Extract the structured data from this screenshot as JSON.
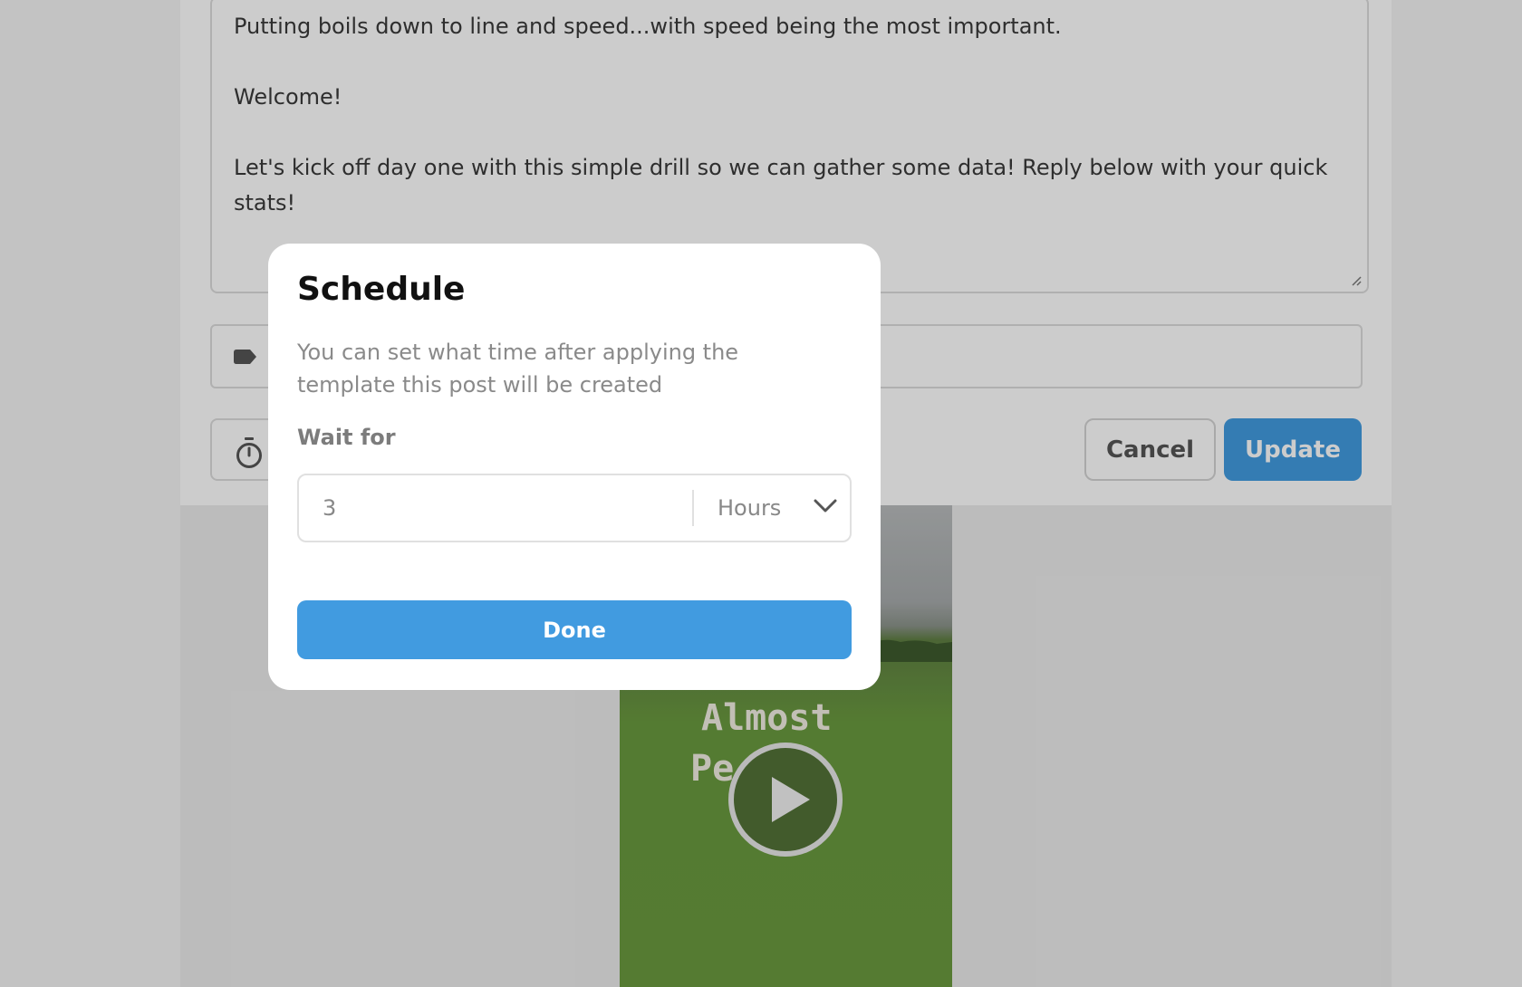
{
  "post": {
    "paragraphs": [
      "Putting boils down to line and speed...with speed being the most important.",
      "Welcome!",
      "Let's kick off day one with this simple drill so we can gather some data! Reply below with your quick stats!"
    ]
  },
  "actions": {
    "cancel_label": "Cancel",
    "update_label": "Update"
  },
  "video": {
    "caption_line1": "Almost",
    "caption_line2": "Pe"
  },
  "icons": {
    "tag": "tag-icon",
    "timer": "timer-icon",
    "play": "play-icon",
    "chevron": "chevron-down-icon"
  },
  "modal": {
    "title": "Schedule",
    "description": "You can set what time after applying the template this post will be created",
    "wait_label": "Wait for",
    "wait_value": "3",
    "unit_selected": "Hours",
    "done_label": "Done"
  },
  "colors": {
    "accent": "#419be0"
  }
}
